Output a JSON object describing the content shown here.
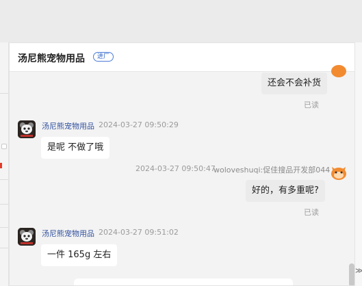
{
  "header": {
    "shop_name": "汤尼熊宠物用品",
    "badge": "进厂"
  },
  "messages": [
    {
      "direction": "out",
      "text": "还会不会补货",
      "status": "已读"
    },
    {
      "direction": "in",
      "sender": "汤尼熊宠物用品",
      "time": "2024-03-27 09:50:29",
      "text": "是呢  不做了哦"
    },
    {
      "direction": "out",
      "time": "2024-03-27 09:50:47",
      "sender": "woloveshuqi:促佳搜品开发部044",
      "text": "好的，有多重呢?",
      "status": "已读"
    },
    {
      "direction": "in",
      "sender": "汤尼熊宠物用品",
      "time": "2024-03-27 09:51:02",
      "text": "一件 165g 左右"
    }
  ],
  "controls": {
    "collapse_label": "≫"
  },
  "colors": {
    "sender_name": "#2f4f9e",
    "badge_blue": "#2f63c5",
    "chat_bg": "#f3f3f3",
    "bubble_in": "#ffffff",
    "bubble_out": "#ebebeb",
    "avatar_orange": "#f28b30"
  },
  "icons": {
    "shop_avatar": "panda-avatar-icon",
    "user_avatar": "orange-cat-avatar-icon"
  }
}
